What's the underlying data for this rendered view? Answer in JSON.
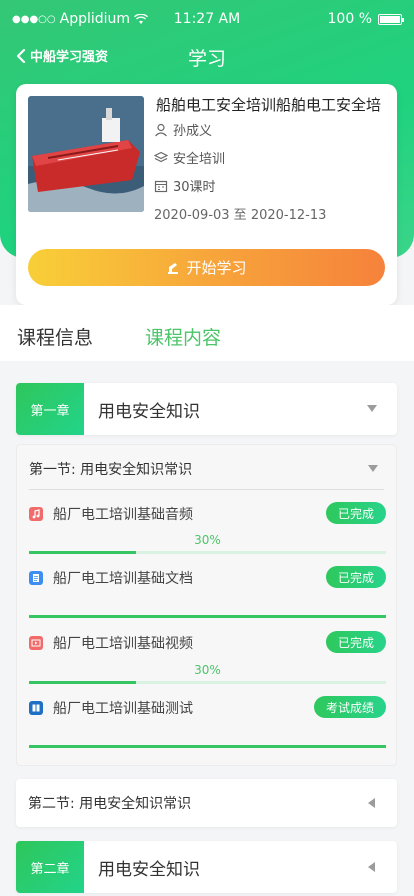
{
  "status_bar": {
    "signal": "●●●○○",
    "carrier": "Applidium",
    "time": "11:27 AM",
    "battery": "100 %"
  },
  "nav": {
    "back_label": "中船学习强资",
    "title": "学习"
  },
  "course": {
    "title": "船舶电工安全培训船舶电工安全培",
    "teacher": "孙成义",
    "category": "安全培训",
    "hours": "30课时",
    "date_range": "2020-09-03 至 2020-12-13",
    "start_button": "开始学习"
  },
  "tabs": [
    {
      "label": "课程信息"
    },
    {
      "label": "课程内容"
    }
  ],
  "chapters": [
    {
      "badge": "第一章",
      "name": "用电安全知识"
    },
    {
      "badge": "第二章",
      "name": "用电安全知识"
    }
  ],
  "sections": [
    {
      "label": "第一节: 用电安全知识常识"
    },
    {
      "label": "第二节: 用电安全知识常识"
    }
  ],
  "items": [
    {
      "label": "船厂电工培训基础音频",
      "status": "已完成",
      "progress_label": "30%",
      "progress": 0.3,
      "icon": "music-icon",
      "icon_color": "#f26b6b"
    },
    {
      "label": "船厂电工培训基础文档",
      "status": "已完成",
      "progress_label": "",
      "progress": 1.0,
      "icon": "document-icon",
      "icon_color": "#3d8ef0"
    },
    {
      "label": "船厂电工培训基础视频",
      "status": "已完成",
      "progress_label": "30%",
      "progress": 0.3,
      "icon": "video-icon",
      "icon_color": "#f26b6b"
    },
    {
      "label": "船厂电工培训基础测试",
      "status": "考试成绩",
      "progress_label": "",
      "progress": 1.0,
      "icon": "book-icon",
      "icon_color": "#1f6fc4"
    }
  ],
  "colors": {
    "primary_green": "#2fc65b",
    "accent_orange": "#f6823b"
  }
}
